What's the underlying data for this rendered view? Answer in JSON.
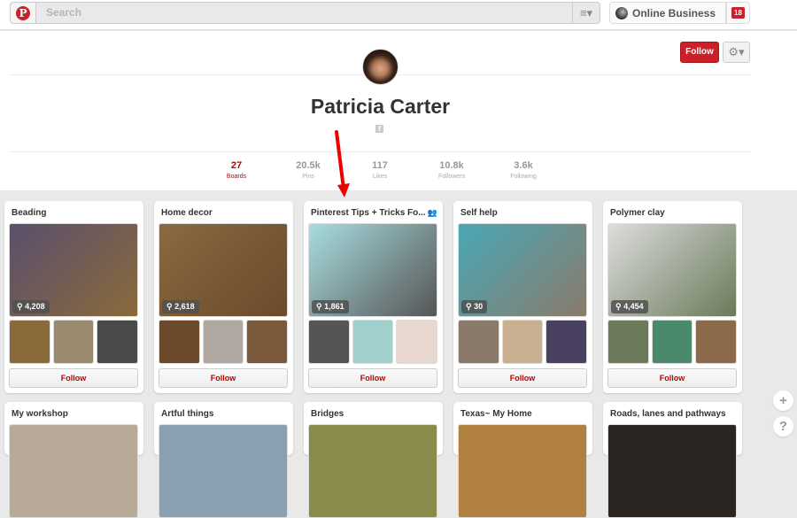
{
  "header": {
    "logo": "P",
    "search_placeholder": "Search",
    "menu_icon": "≡▾",
    "user_name": "Online Business",
    "notification_count": "18"
  },
  "profile": {
    "name": "Patricia Carter",
    "follow_label": "Follow",
    "gear_icon": "⚙▾",
    "facebook_icon": "f",
    "stats": [
      {
        "value": "27",
        "label": "Boards",
        "active": true
      },
      {
        "value": "20.5k",
        "label": "Pins"
      },
      {
        "value": "117",
        "label": "Likes"
      },
      {
        "value": "10.8k",
        "label": "Followers"
      },
      {
        "value": "3.6k",
        "label": "Following"
      }
    ]
  },
  "boards": [
    {
      "title": "Beading",
      "pins": "⚲ 4,208",
      "follow": "Follow",
      "colors": [
        "#5a4f6e",
        "#8a6a3a",
        "#9a8a70",
        "#4a4a4a"
      ]
    },
    {
      "title": "Home decor",
      "pins": "⚲ 2,618",
      "follow": "Follow",
      "colors": [
        "#8a6a40",
        "#6a4a2a",
        "#b0a8a0",
        "#7a5a3a"
      ]
    },
    {
      "title": "Pinterest Tips + Tricks Fo...",
      "pins": "⚲ 1,861",
      "follow": "Follow",
      "collab_icon": "👥",
      "colors": [
        "#a8dde0",
        "#555",
        "#9fd0cc",
        "#e8d8d0"
      ]
    },
    {
      "title": "Self help",
      "pins": "⚲ 30",
      "follow": "Follow",
      "colors": [
        "#4aa8b5",
        "#8a7a6a",
        "#c8b090",
        "#4a4060"
      ]
    },
    {
      "title": "Polymer clay",
      "pins": "⚲ 4,454",
      "follow": "Follow",
      "colors": [
        "#ddd",
        "#6a7a5a",
        "#4a8a6a",
        "#8a6a4a"
      ]
    },
    {
      "title": "My workshop",
      "colors": [
        "#b8aa98"
      ]
    },
    {
      "title": "Artful things",
      "colors": [
        "#8aa0b0"
      ]
    },
    {
      "title": "Bridges",
      "colors": [
        "#8a8a4a"
      ]
    },
    {
      "title": "Texas~ My Home",
      "colors": [
        "#b08040"
      ]
    },
    {
      "title": "Roads, lanes and pathways",
      "colors": [
        "#2a2520"
      ]
    }
  ],
  "side_buttons": {
    "add": "+",
    "help": "?"
  }
}
